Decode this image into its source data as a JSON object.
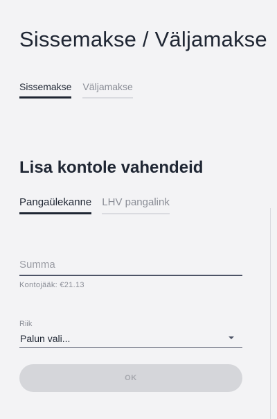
{
  "header": {
    "title": "Sissemakse / Väljamakse"
  },
  "main_tabs": [
    {
      "label": "Sissemakse",
      "active": true
    },
    {
      "label": "Väljamakse",
      "active": false
    }
  ],
  "section": {
    "title": "Lisa kontole vahendeid"
  },
  "sub_tabs": [
    {
      "label": "Pangaülekanne",
      "active": true
    },
    {
      "label": "LHV pangalink",
      "active": false
    }
  ],
  "form": {
    "amount_placeholder": "Summa",
    "amount_value": "",
    "balance_text": "Kontojääk: €21.13",
    "country_label": "Riik",
    "country_value": "Palun vali...",
    "ok_label": "OK",
    "ok_enabled": false
  },
  "colors": {
    "text": "#1f2633",
    "muted": "#8a8d96",
    "background": "#f3f3f5",
    "disabled_button": "#d5d6da"
  },
  "icons": {
    "country_dropdown": "caret-down-icon"
  }
}
